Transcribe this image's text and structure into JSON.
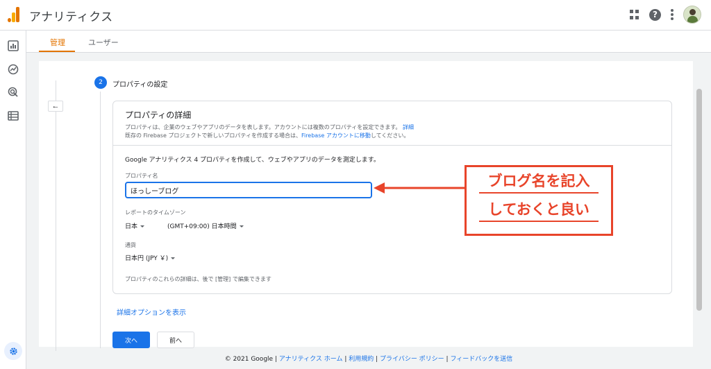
{
  "app": {
    "title": "アナリティクス"
  },
  "tabs": [
    {
      "label": "管理",
      "active": true
    },
    {
      "label": "ユーザー",
      "active": false
    }
  ],
  "nav_icons": [
    "reports-icon",
    "explore-icon",
    "advertising-icon",
    "configure-icon",
    "settings-gear-icon"
  ],
  "step": {
    "number": "2",
    "title": "プロパティの設定",
    "back_label": "←"
  },
  "card": {
    "title": "プロパティの詳細",
    "desc_line1": "プロパティは、企業のウェブやアプリのデータを表します。アカウントには複数のプロパティを設定できます。",
    "desc_line1_link": "詳細",
    "desc_line2_prefix": "既存の Firebase プロジェクトで新しいプロパティを作成する場合は、",
    "desc_line2_link": "Firebase アカウントに移動",
    "desc_line2_suffix": "してください。",
    "intro": "Google アナリティクス 4 プロパティを作成して、ウェブやアプリのデータを測定します。",
    "property_name_label": "プロパティ名",
    "property_name_value": "ほっしーブログ",
    "timezone_label": "レポートのタイムゾーン",
    "timezone_country": "日本",
    "timezone_value": "(GMT+09:00) 日本時間",
    "currency_label": "通貨",
    "currency_value": "日本円 (JPY ￥)",
    "footnote": "プロパティのこれらの詳細は、後で [管理] で編集できます"
  },
  "advanced_link": "詳細オプションを表示",
  "buttons": {
    "next": "次へ",
    "prev": "前へ"
  },
  "callout": {
    "line1": "ブログ名を記入",
    "line2": "しておくと良い"
  },
  "footer": {
    "copyright": "© 2021 Google",
    "links": [
      "アナリティクス ホーム",
      "利用規約",
      "プライバシー ポリシー",
      "フィードバックを送信"
    ]
  },
  "colors": {
    "accent": "#1a73e8",
    "brand": "#e37400",
    "annotation": "#e8442a"
  }
}
